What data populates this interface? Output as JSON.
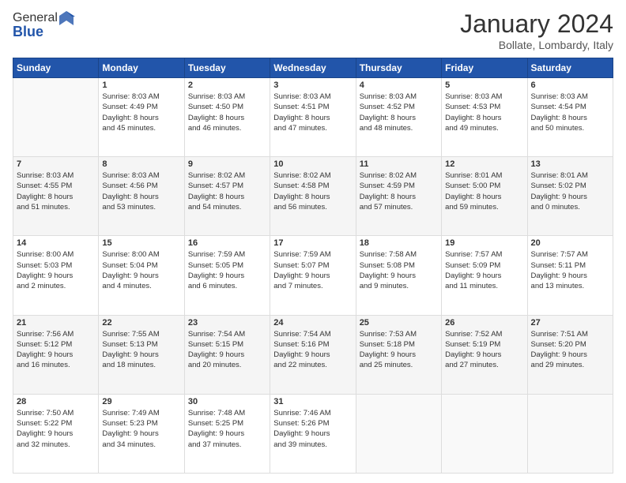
{
  "header": {
    "logo": {
      "general": "General",
      "blue": "Blue"
    },
    "title": "January 2024",
    "location": "Bollate, Lombardy, Italy"
  },
  "days_of_week": [
    "Sunday",
    "Monday",
    "Tuesday",
    "Wednesday",
    "Thursday",
    "Friday",
    "Saturday"
  ],
  "weeks": [
    [
      {
        "day": "",
        "info": ""
      },
      {
        "day": "1",
        "info": "Sunrise: 8:03 AM\nSunset: 4:49 PM\nDaylight: 8 hours\nand 45 minutes."
      },
      {
        "day": "2",
        "info": "Sunrise: 8:03 AM\nSunset: 4:50 PM\nDaylight: 8 hours\nand 46 minutes."
      },
      {
        "day": "3",
        "info": "Sunrise: 8:03 AM\nSunset: 4:51 PM\nDaylight: 8 hours\nand 47 minutes."
      },
      {
        "day": "4",
        "info": "Sunrise: 8:03 AM\nSunset: 4:52 PM\nDaylight: 8 hours\nand 48 minutes."
      },
      {
        "day": "5",
        "info": "Sunrise: 8:03 AM\nSunset: 4:53 PM\nDaylight: 8 hours\nand 49 minutes."
      },
      {
        "day": "6",
        "info": "Sunrise: 8:03 AM\nSunset: 4:54 PM\nDaylight: 8 hours\nand 50 minutes."
      }
    ],
    [
      {
        "day": "7",
        "info": "Sunrise: 8:03 AM\nSunset: 4:55 PM\nDaylight: 8 hours\nand 51 minutes."
      },
      {
        "day": "8",
        "info": "Sunrise: 8:03 AM\nSunset: 4:56 PM\nDaylight: 8 hours\nand 53 minutes."
      },
      {
        "day": "9",
        "info": "Sunrise: 8:02 AM\nSunset: 4:57 PM\nDaylight: 8 hours\nand 54 minutes."
      },
      {
        "day": "10",
        "info": "Sunrise: 8:02 AM\nSunset: 4:58 PM\nDaylight: 8 hours\nand 56 minutes."
      },
      {
        "day": "11",
        "info": "Sunrise: 8:02 AM\nSunset: 4:59 PM\nDaylight: 8 hours\nand 57 minutes."
      },
      {
        "day": "12",
        "info": "Sunrise: 8:01 AM\nSunset: 5:00 PM\nDaylight: 8 hours\nand 59 minutes."
      },
      {
        "day": "13",
        "info": "Sunrise: 8:01 AM\nSunset: 5:02 PM\nDaylight: 9 hours\nand 0 minutes."
      }
    ],
    [
      {
        "day": "14",
        "info": "Sunrise: 8:00 AM\nSunset: 5:03 PM\nDaylight: 9 hours\nand 2 minutes."
      },
      {
        "day": "15",
        "info": "Sunrise: 8:00 AM\nSunset: 5:04 PM\nDaylight: 9 hours\nand 4 minutes."
      },
      {
        "day": "16",
        "info": "Sunrise: 7:59 AM\nSunset: 5:05 PM\nDaylight: 9 hours\nand 6 minutes."
      },
      {
        "day": "17",
        "info": "Sunrise: 7:59 AM\nSunset: 5:07 PM\nDaylight: 9 hours\nand 7 minutes."
      },
      {
        "day": "18",
        "info": "Sunrise: 7:58 AM\nSunset: 5:08 PM\nDaylight: 9 hours\nand 9 minutes."
      },
      {
        "day": "19",
        "info": "Sunrise: 7:57 AM\nSunset: 5:09 PM\nDaylight: 9 hours\nand 11 minutes."
      },
      {
        "day": "20",
        "info": "Sunrise: 7:57 AM\nSunset: 5:11 PM\nDaylight: 9 hours\nand 13 minutes."
      }
    ],
    [
      {
        "day": "21",
        "info": "Sunrise: 7:56 AM\nSunset: 5:12 PM\nDaylight: 9 hours\nand 16 minutes."
      },
      {
        "day": "22",
        "info": "Sunrise: 7:55 AM\nSunset: 5:13 PM\nDaylight: 9 hours\nand 18 minutes."
      },
      {
        "day": "23",
        "info": "Sunrise: 7:54 AM\nSunset: 5:15 PM\nDaylight: 9 hours\nand 20 minutes."
      },
      {
        "day": "24",
        "info": "Sunrise: 7:54 AM\nSunset: 5:16 PM\nDaylight: 9 hours\nand 22 minutes."
      },
      {
        "day": "25",
        "info": "Sunrise: 7:53 AM\nSunset: 5:18 PM\nDaylight: 9 hours\nand 25 minutes."
      },
      {
        "day": "26",
        "info": "Sunrise: 7:52 AM\nSunset: 5:19 PM\nDaylight: 9 hours\nand 27 minutes."
      },
      {
        "day": "27",
        "info": "Sunrise: 7:51 AM\nSunset: 5:20 PM\nDaylight: 9 hours\nand 29 minutes."
      }
    ],
    [
      {
        "day": "28",
        "info": "Sunrise: 7:50 AM\nSunset: 5:22 PM\nDaylight: 9 hours\nand 32 minutes."
      },
      {
        "day": "29",
        "info": "Sunrise: 7:49 AM\nSunset: 5:23 PM\nDaylight: 9 hours\nand 34 minutes."
      },
      {
        "day": "30",
        "info": "Sunrise: 7:48 AM\nSunset: 5:25 PM\nDaylight: 9 hours\nand 37 minutes."
      },
      {
        "day": "31",
        "info": "Sunrise: 7:46 AM\nSunset: 5:26 PM\nDaylight: 9 hours\nand 39 minutes."
      },
      {
        "day": "",
        "info": ""
      },
      {
        "day": "",
        "info": ""
      },
      {
        "day": "",
        "info": ""
      }
    ]
  ]
}
